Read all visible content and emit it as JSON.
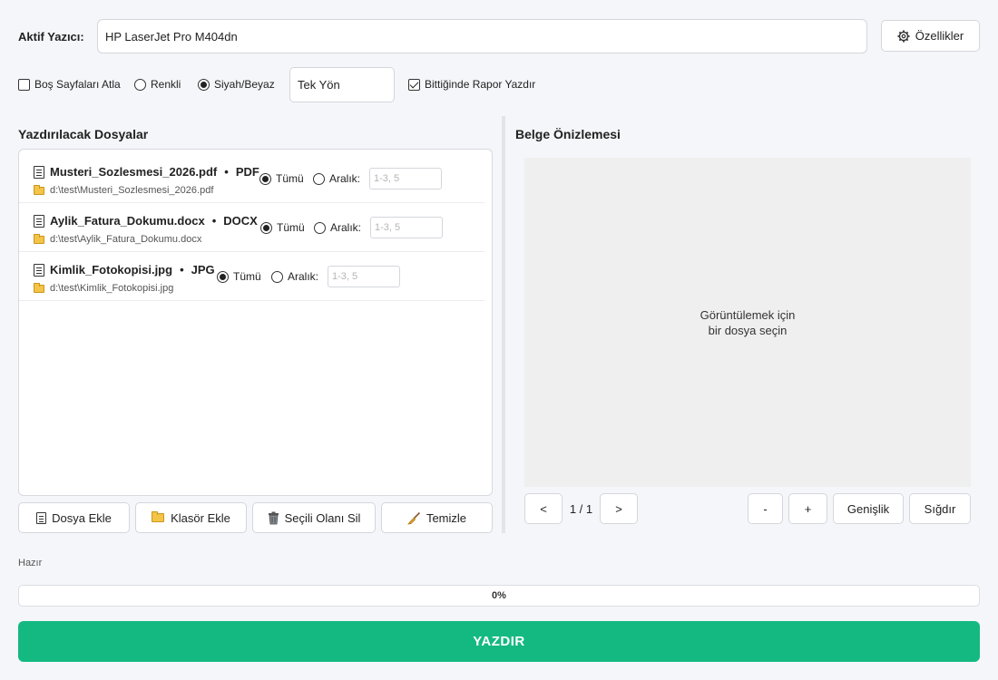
{
  "printer": {
    "label": "Aktif Yazıcı:",
    "value": "HP LaserJet Pro M404dn",
    "properties_button": "Özellikler"
  },
  "options": {
    "skip_blank": {
      "label": "Boş Sayfaları Atla",
      "checked": false
    },
    "color": {
      "label": "Renkli",
      "selected": false
    },
    "bw": {
      "label": "Siyah/Beyaz",
      "selected": true
    },
    "duplex": {
      "value": "Tek Yön"
    },
    "report": {
      "label": "Bittiğinde Rapor Yazdır",
      "checked": true
    }
  },
  "files_panel": {
    "title": "Yazdırılacak Dosyalar",
    "files": [
      {
        "name": "Musteri_Sozlesmesi_2026.pdf",
        "type": "PDF",
        "path": "d:\\test\\Musteri_Sozlesmesi_2026.pdf",
        "all_label": "Tümü",
        "range_label": "Aralık:",
        "range_placeholder": "1-3, 5"
      },
      {
        "name": "Aylik_Fatura_Dokumu.docx",
        "type": "DOCX",
        "path": "d:\\test\\Aylik_Fatura_Dokumu.docx",
        "all_label": "Tümü",
        "range_label": "Aralık:",
        "range_placeholder": "1-3, 5"
      },
      {
        "name": "Kimlik_Fotokopisi.jpg",
        "type": "JPG",
        "path": "d:\\test\\Kimlik_Fotokopisi.jpg",
        "all_label": "Tümü",
        "range_label": "Aralık:",
        "range_placeholder": "1-3, 5"
      }
    ],
    "separator": "•",
    "buttons": {
      "add_file": "Dosya Ekle",
      "add_folder": "Klasör Ekle",
      "delete_selected": "Seçili Olanı Sil",
      "clear": "Temizle"
    }
  },
  "preview": {
    "title": "Belge Önizlemesi",
    "placeholder_line1": "Görüntülemek için",
    "placeholder_line2": "bir dosya seçin",
    "prev": "<",
    "next": ">",
    "page_indicator": "1 / 1",
    "zoom_out": "-",
    "zoom_in": "+",
    "fit_width": "Genişlik",
    "fit_page": "Sığdır"
  },
  "status": {
    "text": "Hazır",
    "progress_text": "0%",
    "progress": 0
  },
  "print_button": "YAZDIR",
  "colors": {
    "accent_green": "#14b981",
    "preview_bg": "#efefef",
    "page_bg": "#f5f6fa"
  },
  "icons": {
    "properties": "gear-icon",
    "file": "document-icon",
    "folder": "folder-icon",
    "delete": "trash-icon",
    "clear": "broom-icon"
  }
}
